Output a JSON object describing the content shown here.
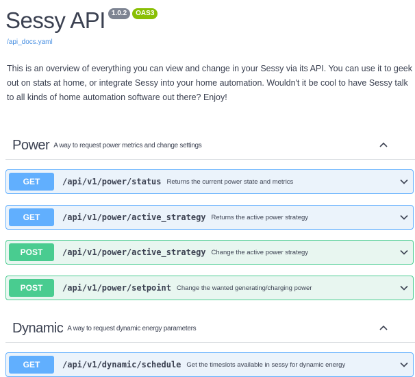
{
  "info": {
    "title": "Sessy API",
    "version": "1.0.2",
    "oas_badge": "OAS3",
    "spec_link": "/api_docs.yaml",
    "description": "This is an overview of everything you can view and change in your Sessy via its API. You can use it to geek out on stats at home, or integrate Sessy into your home automation. Wouldn't it be cool to have Sessy talk to all kinds of home automation software out there? Enjoy!"
  },
  "tags": [
    {
      "name": "Power",
      "description": "A way to request power metrics and change settings",
      "collapse_icon": "chevron-up-icon",
      "operations": [
        {
          "method": "GET",
          "path": "/api/v1/power/status",
          "summary": "Returns the current power state and metrics",
          "expand_icon": "chevron-down-icon"
        },
        {
          "method": "GET",
          "path": "/api/v1/power/active_strategy",
          "summary": "Returns the active power strategy",
          "expand_icon": "chevron-down-icon"
        },
        {
          "method": "POST",
          "path": "/api/v1/power/active_strategy",
          "summary": "Change the active power strategy",
          "expand_icon": "chevron-down-icon"
        },
        {
          "method": "POST",
          "path": "/api/v1/power/setpoint",
          "summary": "Change the wanted generating/charging power",
          "expand_icon": "chevron-down-icon"
        }
      ]
    },
    {
      "name": "Dynamic",
      "description": "A way to request dynamic energy parameters",
      "collapse_icon": "chevron-up-icon",
      "operations": [
        {
          "method": "GET",
          "path": "/api/v1/dynamic/schedule",
          "summary": "Get the timeslots available in sessy for dynamic energy",
          "expand_icon": "chevron-down-icon"
        }
      ]
    }
  ],
  "colors": {
    "get": "#61affe",
    "post": "#49cc90",
    "get_bg": "#ebf3fb",
    "post_bg": "#e8f6f0",
    "version_badge": "#7d8492",
    "oas_badge": "#89bf04",
    "link": "#4990e2",
    "text": "#3b4151"
  }
}
